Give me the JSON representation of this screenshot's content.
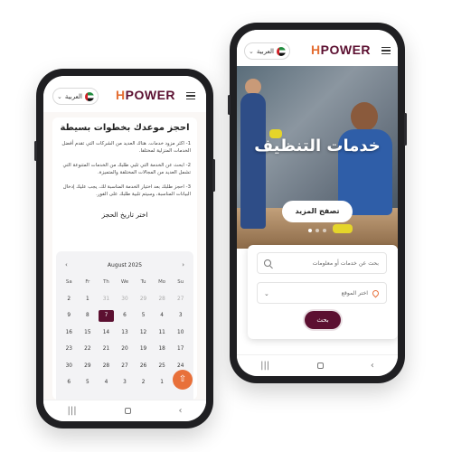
{
  "brand": {
    "logo_h": "H",
    "logo_rest": "POWER"
  },
  "header": {
    "language_label": "العربية"
  },
  "left_screen": {
    "heading": "احجز موعدك بخطوات بسيطة",
    "steps": [
      "1- اكثر مزود خدمات. هناك العديد من الشركات التي تقدم أفضل الخدمات المنزلية لمختلفا.",
      "2- ابحث عن الخدمة التي تلبي طلبك من الخدمات المتنوعة التي تشمل العديد من المجالات المختلفة والمتميزة.",
      "3- احجز طلبك بعد اختيار الخدمة المناسبة لك، يجب عليك إدخال البيانات المناسبة، وسيتم تلبية طلبك على الفور."
    ],
    "date_title": "اختر تاريخ الحجز",
    "calendar": {
      "month_label": "August 2025",
      "prev": "‹",
      "next": "›",
      "weekdays": [
        "Sa",
        "Fr",
        "Th",
        "We",
        "Tu",
        "Mo",
        "Su"
      ],
      "weeks": [
        [
          "2",
          "1",
          "31",
          "30",
          "29",
          "28",
          "27"
        ],
        [
          "9",
          "8",
          "7",
          "6",
          "5",
          "4",
          "3"
        ],
        [
          "16",
          "15",
          "14",
          "13",
          "12",
          "11",
          "10"
        ],
        [
          "23",
          "22",
          "21",
          "20",
          "19",
          "18",
          "17"
        ],
        [
          "30",
          "29",
          "28",
          "27",
          "26",
          "25",
          "24"
        ],
        [
          "6",
          "5",
          "4",
          "3",
          "2",
          "1",
          "31"
        ]
      ],
      "muted_first_row_from": 2,
      "selected": "7"
    }
  },
  "right_screen": {
    "hero_title": "خدمات التنظيف",
    "hero_button": "تصفح المزيد",
    "search_placeholder": "بحث عن خدمات أو معلومات",
    "location_placeholder": "اختر الموقع",
    "search_button": "بحث"
  },
  "nav": {
    "recent": "|||",
    "back": "‹"
  },
  "fab_icon": "⇧",
  "colors": {
    "brand": "#5c1031",
    "accent": "#e8703a"
  }
}
